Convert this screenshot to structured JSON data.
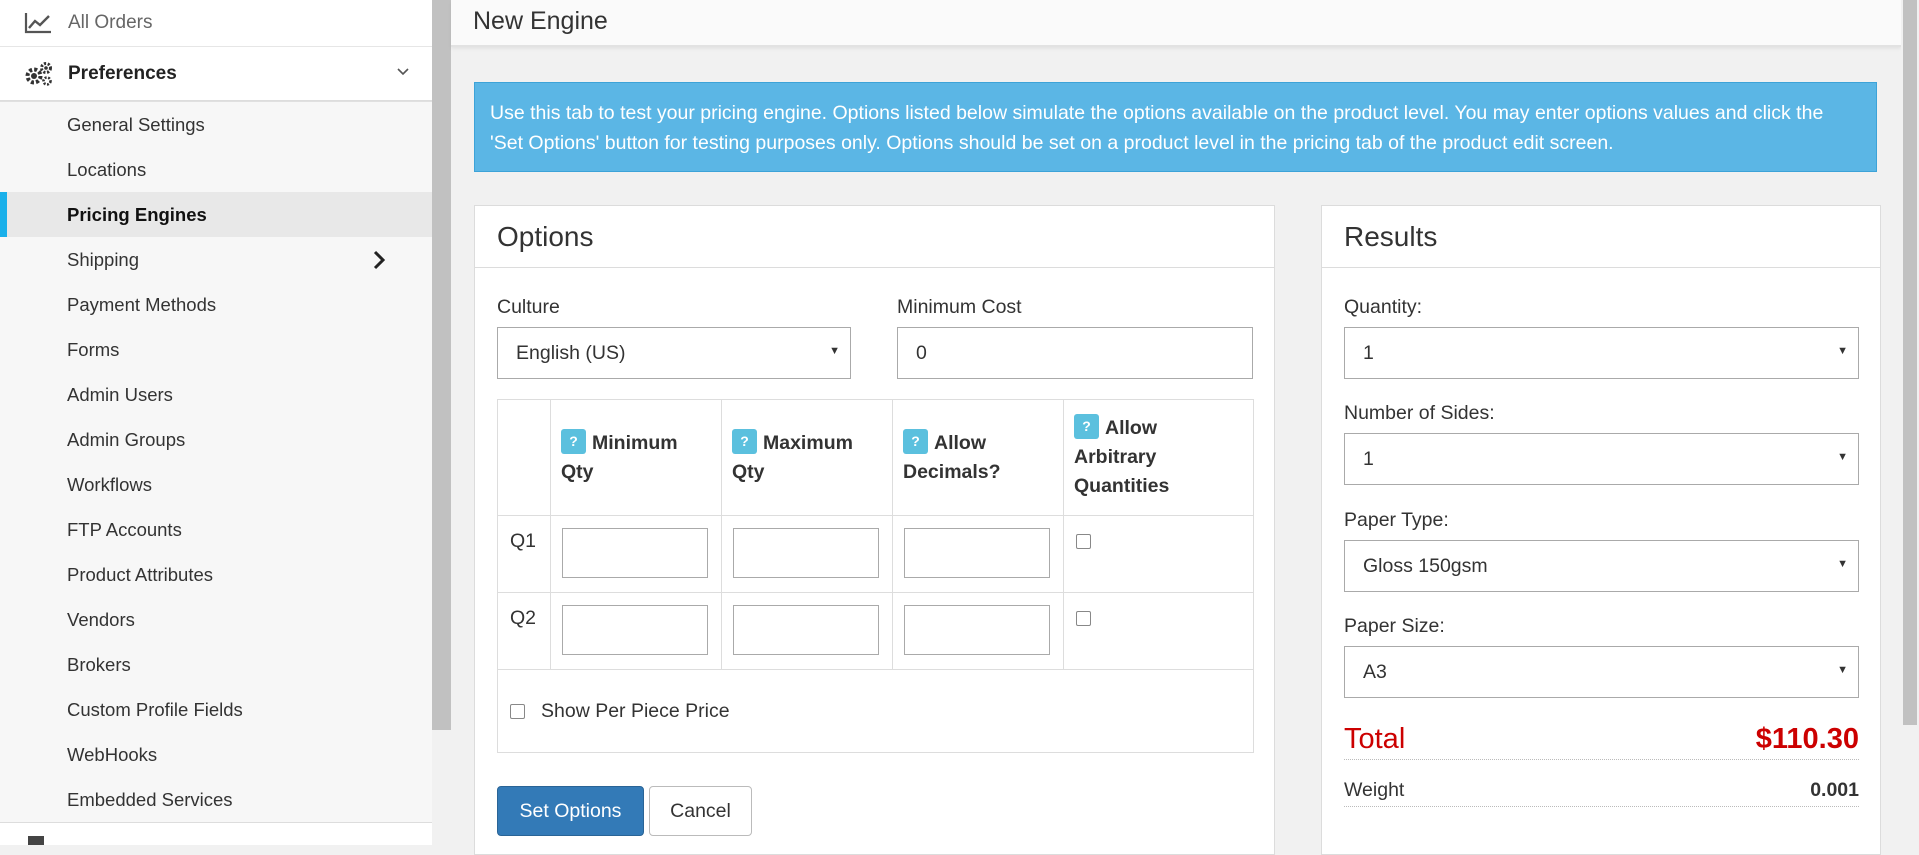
{
  "sidebar": {
    "top_item": {
      "label": "All Orders",
      "icon": "chart-line-icon"
    },
    "preferences": {
      "label": "Preferences",
      "icon": "gears-icon"
    },
    "items": [
      {
        "label": "General Settings"
      },
      {
        "label": "Locations"
      },
      {
        "label": "Pricing Engines",
        "active": true
      },
      {
        "label": "Shipping",
        "has_submenu": true
      },
      {
        "label": "Payment Methods"
      },
      {
        "label": "Forms"
      },
      {
        "label": "Admin Users"
      },
      {
        "label": "Admin Groups"
      },
      {
        "label": "Workflows"
      },
      {
        "label": "FTP Accounts"
      },
      {
        "label": "Product Attributes"
      },
      {
        "label": "Vendors"
      },
      {
        "label": "Brokers"
      },
      {
        "label": "Custom Profile Fields"
      },
      {
        "label": "WebHooks"
      },
      {
        "label": "Embedded Services"
      }
    ]
  },
  "header": {
    "title": "New Engine"
  },
  "info": {
    "text": "Use this tab to test your pricing engine. Options listed below simulate the options available on the product level. You may enter options values and click the 'Set Options' button for testing purposes only. Options should be set on a product level in the pricing tab of the product edit screen."
  },
  "options": {
    "title": "Options",
    "culture_label": "Culture",
    "culture_value": "English (US)",
    "min_cost_label": "Minimum Cost",
    "min_cost_value": "0",
    "help_glyph": "?",
    "table_headers": {
      "min_qty": "Minimum Qty",
      "max_qty": "Maximum Qty",
      "allow_decimals": "Allow Decimals?",
      "allow_arbitrary": "Allow Arbitrary Quantities"
    },
    "rows": [
      {
        "label": "Q1"
      },
      {
        "label": "Q2"
      }
    ],
    "per_piece_label": "Show Per Piece Price",
    "set_options_label": "Set Options",
    "cancel_label": "Cancel"
  },
  "results": {
    "title": "Results",
    "quantity_label": "Quantity:",
    "quantity_value": "1",
    "sides_label": "Number of Sides:",
    "sides_value": "1",
    "paper_type_label": "Paper Type:",
    "paper_type_value": "Gloss 150gsm",
    "paper_size_label": "Paper Size:",
    "paper_size_value": "A3",
    "total_label": "Total",
    "total_value": "$110.30",
    "weight_label": "Weight",
    "weight_value": "0.001"
  },
  "colors": {
    "accent": "#1ab0ea",
    "info_bg": "#5bb6e5",
    "primary_button": "#337ab7",
    "total": "#cc0000",
    "help_badge": "#5bc0de"
  }
}
